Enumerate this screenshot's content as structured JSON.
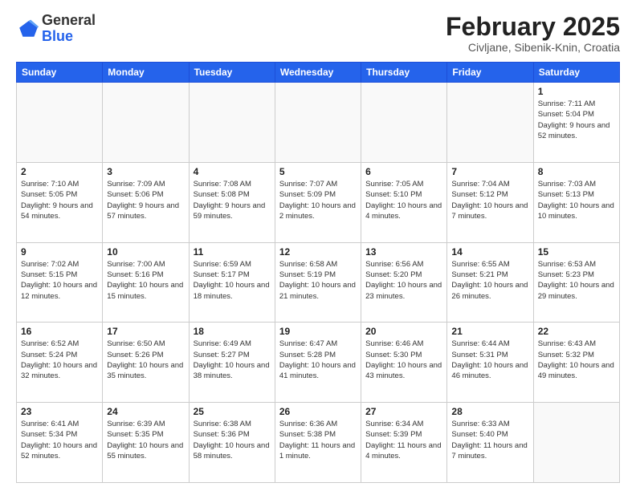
{
  "header": {
    "logo_general": "General",
    "logo_blue": "Blue",
    "month_title": "February 2025",
    "location": "Civljane, Sibenik-Knin, Croatia"
  },
  "days_of_week": [
    "Sunday",
    "Monday",
    "Tuesday",
    "Wednesday",
    "Thursday",
    "Friday",
    "Saturday"
  ],
  "weeks": [
    [
      {
        "num": "",
        "info": ""
      },
      {
        "num": "",
        "info": ""
      },
      {
        "num": "",
        "info": ""
      },
      {
        "num": "",
        "info": ""
      },
      {
        "num": "",
        "info": ""
      },
      {
        "num": "",
        "info": ""
      },
      {
        "num": "1",
        "info": "Sunrise: 7:11 AM\nSunset: 5:04 PM\nDaylight: 9 hours and 52 minutes."
      }
    ],
    [
      {
        "num": "2",
        "info": "Sunrise: 7:10 AM\nSunset: 5:05 PM\nDaylight: 9 hours and 54 minutes."
      },
      {
        "num": "3",
        "info": "Sunrise: 7:09 AM\nSunset: 5:06 PM\nDaylight: 9 hours and 57 minutes."
      },
      {
        "num": "4",
        "info": "Sunrise: 7:08 AM\nSunset: 5:08 PM\nDaylight: 9 hours and 59 minutes."
      },
      {
        "num": "5",
        "info": "Sunrise: 7:07 AM\nSunset: 5:09 PM\nDaylight: 10 hours and 2 minutes."
      },
      {
        "num": "6",
        "info": "Sunrise: 7:05 AM\nSunset: 5:10 PM\nDaylight: 10 hours and 4 minutes."
      },
      {
        "num": "7",
        "info": "Sunrise: 7:04 AM\nSunset: 5:12 PM\nDaylight: 10 hours and 7 minutes."
      },
      {
        "num": "8",
        "info": "Sunrise: 7:03 AM\nSunset: 5:13 PM\nDaylight: 10 hours and 10 minutes."
      }
    ],
    [
      {
        "num": "9",
        "info": "Sunrise: 7:02 AM\nSunset: 5:15 PM\nDaylight: 10 hours and 12 minutes."
      },
      {
        "num": "10",
        "info": "Sunrise: 7:00 AM\nSunset: 5:16 PM\nDaylight: 10 hours and 15 minutes."
      },
      {
        "num": "11",
        "info": "Sunrise: 6:59 AM\nSunset: 5:17 PM\nDaylight: 10 hours and 18 minutes."
      },
      {
        "num": "12",
        "info": "Sunrise: 6:58 AM\nSunset: 5:19 PM\nDaylight: 10 hours and 21 minutes."
      },
      {
        "num": "13",
        "info": "Sunrise: 6:56 AM\nSunset: 5:20 PM\nDaylight: 10 hours and 23 minutes."
      },
      {
        "num": "14",
        "info": "Sunrise: 6:55 AM\nSunset: 5:21 PM\nDaylight: 10 hours and 26 minutes."
      },
      {
        "num": "15",
        "info": "Sunrise: 6:53 AM\nSunset: 5:23 PM\nDaylight: 10 hours and 29 minutes."
      }
    ],
    [
      {
        "num": "16",
        "info": "Sunrise: 6:52 AM\nSunset: 5:24 PM\nDaylight: 10 hours and 32 minutes."
      },
      {
        "num": "17",
        "info": "Sunrise: 6:50 AM\nSunset: 5:26 PM\nDaylight: 10 hours and 35 minutes."
      },
      {
        "num": "18",
        "info": "Sunrise: 6:49 AM\nSunset: 5:27 PM\nDaylight: 10 hours and 38 minutes."
      },
      {
        "num": "19",
        "info": "Sunrise: 6:47 AM\nSunset: 5:28 PM\nDaylight: 10 hours and 41 minutes."
      },
      {
        "num": "20",
        "info": "Sunrise: 6:46 AM\nSunset: 5:30 PM\nDaylight: 10 hours and 43 minutes."
      },
      {
        "num": "21",
        "info": "Sunrise: 6:44 AM\nSunset: 5:31 PM\nDaylight: 10 hours and 46 minutes."
      },
      {
        "num": "22",
        "info": "Sunrise: 6:43 AM\nSunset: 5:32 PM\nDaylight: 10 hours and 49 minutes."
      }
    ],
    [
      {
        "num": "23",
        "info": "Sunrise: 6:41 AM\nSunset: 5:34 PM\nDaylight: 10 hours and 52 minutes."
      },
      {
        "num": "24",
        "info": "Sunrise: 6:39 AM\nSunset: 5:35 PM\nDaylight: 10 hours and 55 minutes."
      },
      {
        "num": "25",
        "info": "Sunrise: 6:38 AM\nSunset: 5:36 PM\nDaylight: 10 hours and 58 minutes."
      },
      {
        "num": "26",
        "info": "Sunrise: 6:36 AM\nSunset: 5:38 PM\nDaylight: 11 hours and 1 minute."
      },
      {
        "num": "27",
        "info": "Sunrise: 6:34 AM\nSunset: 5:39 PM\nDaylight: 11 hours and 4 minutes."
      },
      {
        "num": "28",
        "info": "Sunrise: 6:33 AM\nSunset: 5:40 PM\nDaylight: 11 hours and 7 minutes."
      },
      {
        "num": "",
        "info": ""
      }
    ]
  ]
}
